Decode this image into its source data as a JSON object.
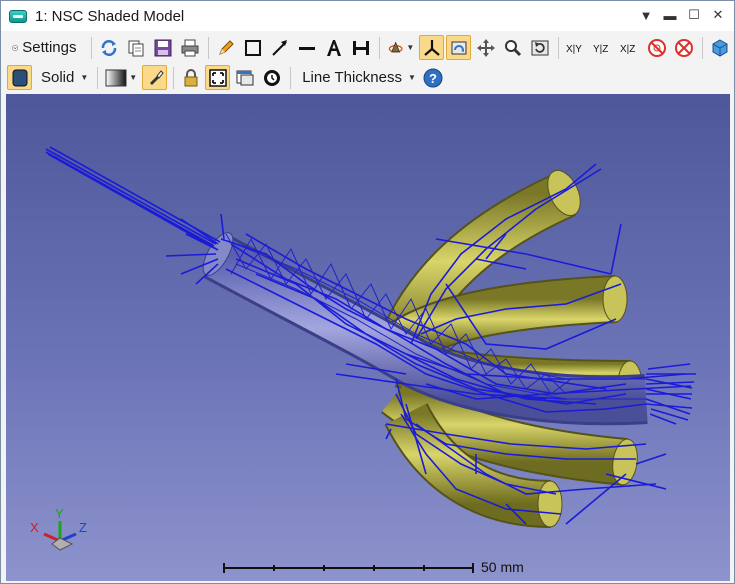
{
  "window": {
    "title": "1: NSC Shaded Model"
  },
  "toolbar1": {
    "settings_label": "Settings"
  },
  "toolbar2": {
    "mode_label": "Solid",
    "line_thickness_label": "Line Thickness"
  },
  "viewport": {
    "scale_bar_label": "50 mm",
    "axes": {
      "x": "X",
      "y": "Y",
      "z": "Z"
    }
  },
  "colors": {
    "background_top": "#4e579a",
    "background_bottom": "#8d93cc",
    "tube": "#b8b44a",
    "rays": "#1b1bd8"
  }
}
